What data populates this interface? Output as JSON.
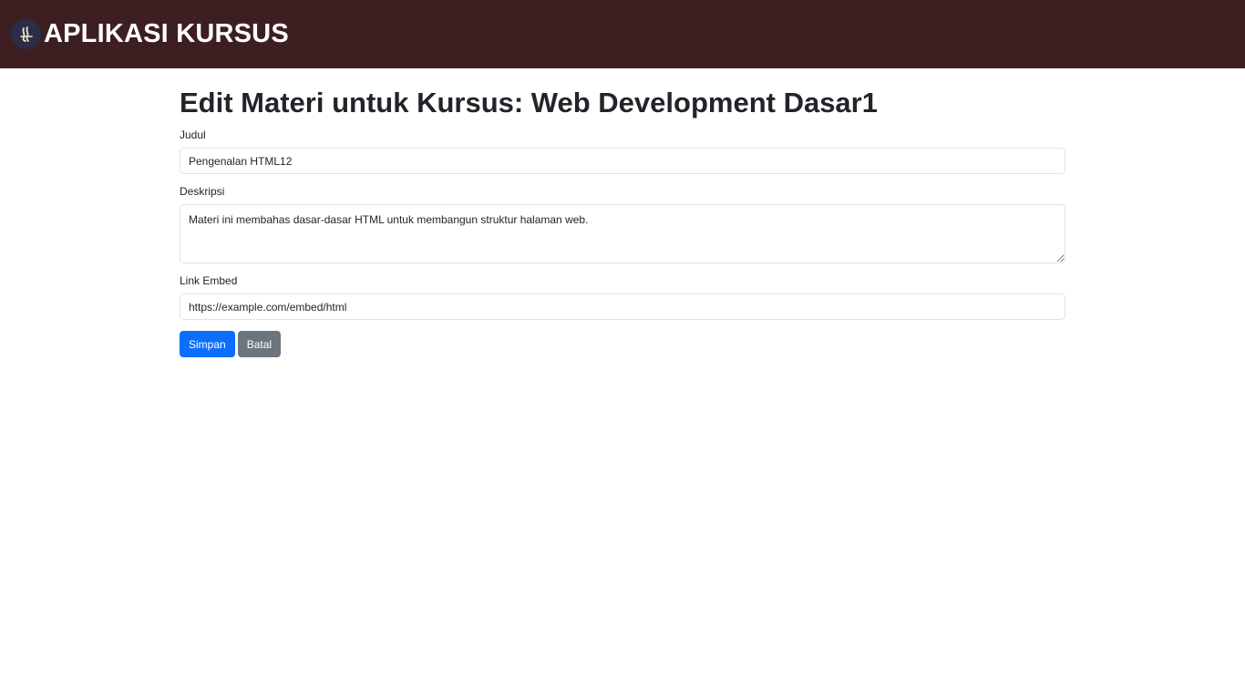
{
  "navbar": {
    "brand_text": "APLIKASI KURSUS",
    "logo_icon": "flame-logo-icon",
    "background_color": "#3d1f21"
  },
  "page": {
    "title": "Edit Materi untuk Kursus: Web Development Dasar1"
  },
  "form": {
    "judul": {
      "label": "Judul",
      "value": "Pengenalan HTML12"
    },
    "deskripsi": {
      "label": "Deskripsi",
      "value": "Materi ini membahas dasar-dasar HTML untuk membangun struktur halaman web."
    },
    "link_embed": {
      "label": "Link Embed",
      "value": "https://example.com/embed/html"
    },
    "save_label": "Simpan",
    "cancel_label": "Batal"
  },
  "colors": {
    "primary": "#0d6efd",
    "secondary": "#6c757d"
  }
}
